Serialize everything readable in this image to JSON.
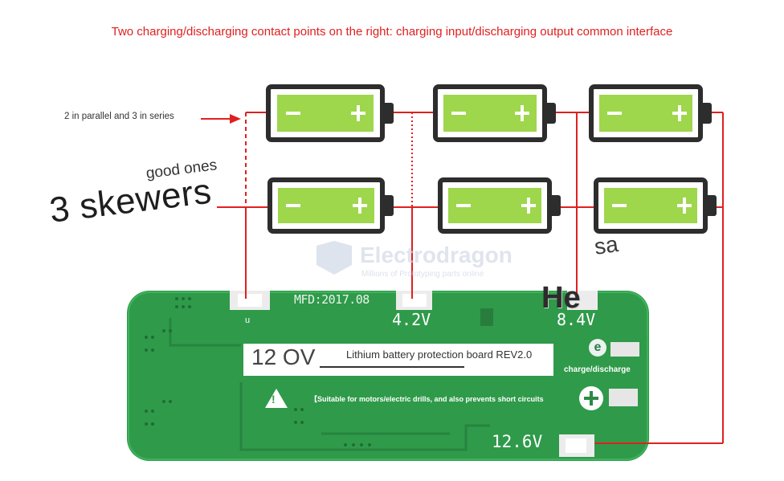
{
  "headline": "Two charging/discharging contact points on the right: charging input/discharging output common interface",
  "annotations": {
    "parallel_series": "2 in parallel and 3 in series",
    "good_ones": "good ones",
    "skewers": "3 skewers",
    "he": "He",
    "sa": "sa"
  },
  "watermark": {
    "brand": "Electrodragon",
    "tagline": "Millions of Prototyping parts online"
  },
  "board": {
    "model": "MFD:2017.08",
    "terminal_u": "u",
    "v1": "4.2V",
    "v2": "8.4V",
    "v3": "12.6V",
    "rating": "12 OV",
    "title": "Lithium battery protection board REV2.0",
    "suitability": "【Suitable for motors/electric drills, and also prevents short circuits",
    "port_label": "charge/discharge",
    "e_icon_glyph": "e",
    "warning_glyph": "!"
  },
  "battery": {
    "minus": "−",
    "plus": "+"
  },
  "colors": {
    "wire": "#e02020",
    "board": "#2f9a4a",
    "battery_fill": "#9ed64c",
    "battery_frame": "#2d2d2d",
    "headline": "#e02020"
  },
  "icons": [
    "battery-icon",
    "warning-icon",
    "e-icon",
    "plus-circle-icon"
  ]
}
